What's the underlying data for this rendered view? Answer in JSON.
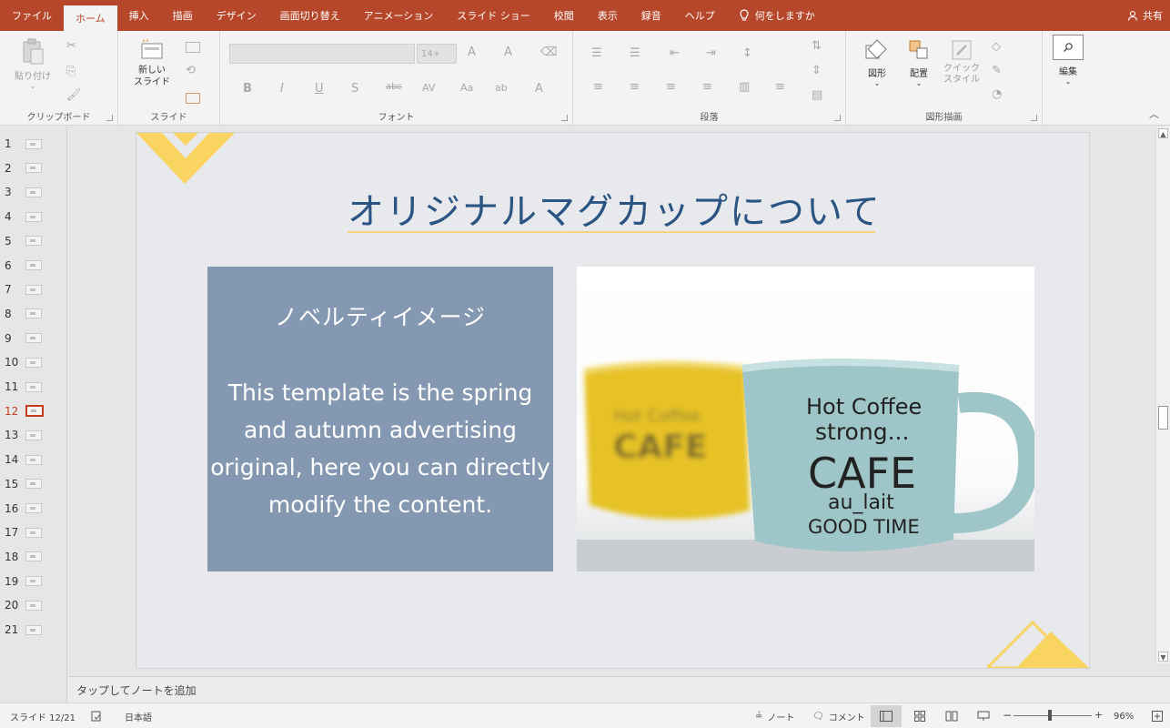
{
  "tabs": [
    {
      "label": "ファイル",
      "active": false
    },
    {
      "label": "ホーム",
      "active": true
    },
    {
      "label": "挿入",
      "active": false
    },
    {
      "label": "描画",
      "active": false
    },
    {
      "label": "デザイン",
      "active": false
    },
    {
      "label": "画面切り替え",
      "active": false
    },
    {
      "label": "アニメーション",
      "active": false
    },
    {
      "label": "スライド ショー",
      "active": false
    },
    {
      "label": "校閲",
      "active": false
    },
    {
      "label": "表示",
      "active": false
    },
    {
      "label": "録音",
      "active": false
    },
    {
      "label": "ヘルプ",
      "active": false
    }
  ],
  "tell_me": "何をしますか",
  "share_label": "共有",
  "ribbon": {
    "clipboard": {
      "paste_label": "貼り付け",
      "group_label": "クリップボード"
    },
    "slides": {
      "new_slide_label": "新しい\nスライド",
      "group_label": "スライド"
    },
    "font": {
      "font_size": "14+",
      "group_label": "フォント"
    },
    "paragraph": {
      "group_label": "段落"
    },
    "drawing": {
      "shapes_label": "図形",
      "arrange_label": "配置",
      "quick_styles_label": "クイック\nスタイル",
      "group_label": "図形描画"
    },
    "editing": {
      "edit_label": "編集"
    }
  },
  "slide_thumbs": [
    {
      "number": "1",
      "active": false
    },
    {
      "number": "2",
      "active": false
    },
    {
      "number": "3",
      "active": false
    },
    {
      "number": "4",
      "active": false
    },
    {
      "number": "5",
      "active": false
    },
    {
      "number": "6",
      "active": false
    },
    {
      "number": "7",
      "active": false
    },
    {
      "number": "8",
      "active": false
    },
    {
      "number": "9",
      "active": false
    },
    {
      "number": "10",
      "active": false
    },
    {
      "number": "11",
      "active": false
    },
    {
      "number": "12",
      "active": true
    },
    {
      "number": "13",
      "active": false
    },
    {
      "number": "14",
      "active": false
    },
    {
      "number": "15",
      "active": false
    },
    {
      "number": "16",
      "active": false
    },
    {
      "number": "17",
      "active": false
    },
    {
      "number": "18",
      "active": false
    },
    {
      "number": "19",
      "active": false
    },
    {
      "number": "20",
      "active": false
    },
    {
      "number": "21",
      "active": false
    }
  ],
  "slide": {
    "title": "オリジナルマグカップについて",
    "box_heading": "ノベルティイメージ",
    "box_body": "This template is the spring and autumn advertising original, here you can directly modify the content.",
    "mug_text": {
      "line1": "Hot Coffee",
      "line2": "strong...",
      "line3": "CAFE",
      "line4": "au_lait",
      "line5": "GOOD TIME"
    },
    "accent_color": "#f9d461",
    "box_color": "#8498b1",
    "title_color": "#2a5582"
  },
  "notes_placeholder": "タップしてノートを追加",
  "status": {
    "slide_counter": "スライド 12/21",
    "language": "日本語",
    "notes_label": "ノート",
    "comments_label": "コメント",
    "zoom": "96%"
  },
  "colors": {
    "brand": "#b7472a",
    "active_thumb": "#c43e1c"
  }
}
